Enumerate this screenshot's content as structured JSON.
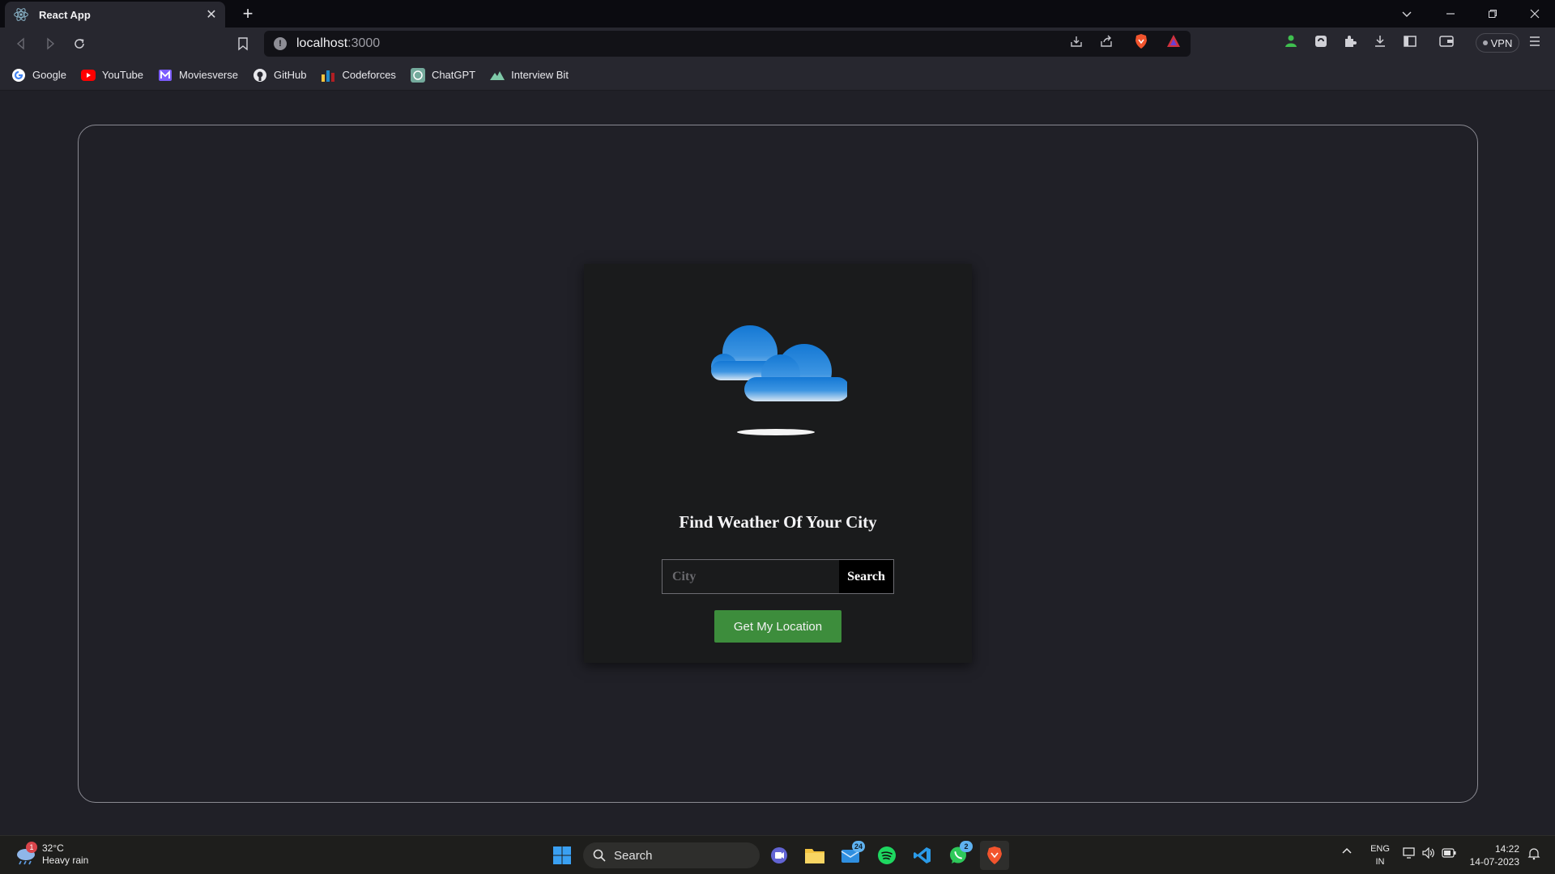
{
  "browser": {
    "tab": {
      "title": "React App"
    },
    "url": {
      "host": "localhost",
      "port": ":3000"
    },
    "vpn_label": "VPN"
  },
  "bookmarks": [
    {
      "label": "Google",
      "icon": "google-icon"
    },
    {
      "label": "YouTube",
      "icon": "youtube-icon"
    },
    {
      "label": "Moviesverse",
      "icon": "moviesverse-icon"
    },
    {
      "label": "GitHub",
      "icon": "github-icon"
    },
    {
      "label": "Codeforces",
      "icon": "codeforces-icon"
    },
    {
      "label": "ChatGPT",
      "icon": "chatgpt-icon"
    },
    {
      "label": "Interview Bit",
      "icon": "interviewbit-icon"
    }
  ],
  "app": {
    "heading": "Find Weather Of Your City",
    "city_placeholder": "City",
    "city_value": "",
    "search_label": "Search",
    "location_label": "Get My Location",
    "colors": {
      "location_button": "#3d8d3c",
      "card": "#1a1b1c",
      "page": "#202027"
    }
  },
  "taskbar": {
    "weather": {
      "temp": "32°C",
      "condition": "Heavy rain",
      "badge": "1"
    },
    "search_label": "Search",
    "mail_count": "24",
    "whatsapp_count": "2",
    "language": {
      "line1": "ENG",
      "line2": "IN"
    },
    "clock": {
      "time": "14:22",
      "date": "14-07-2023"
    }
  }
}
